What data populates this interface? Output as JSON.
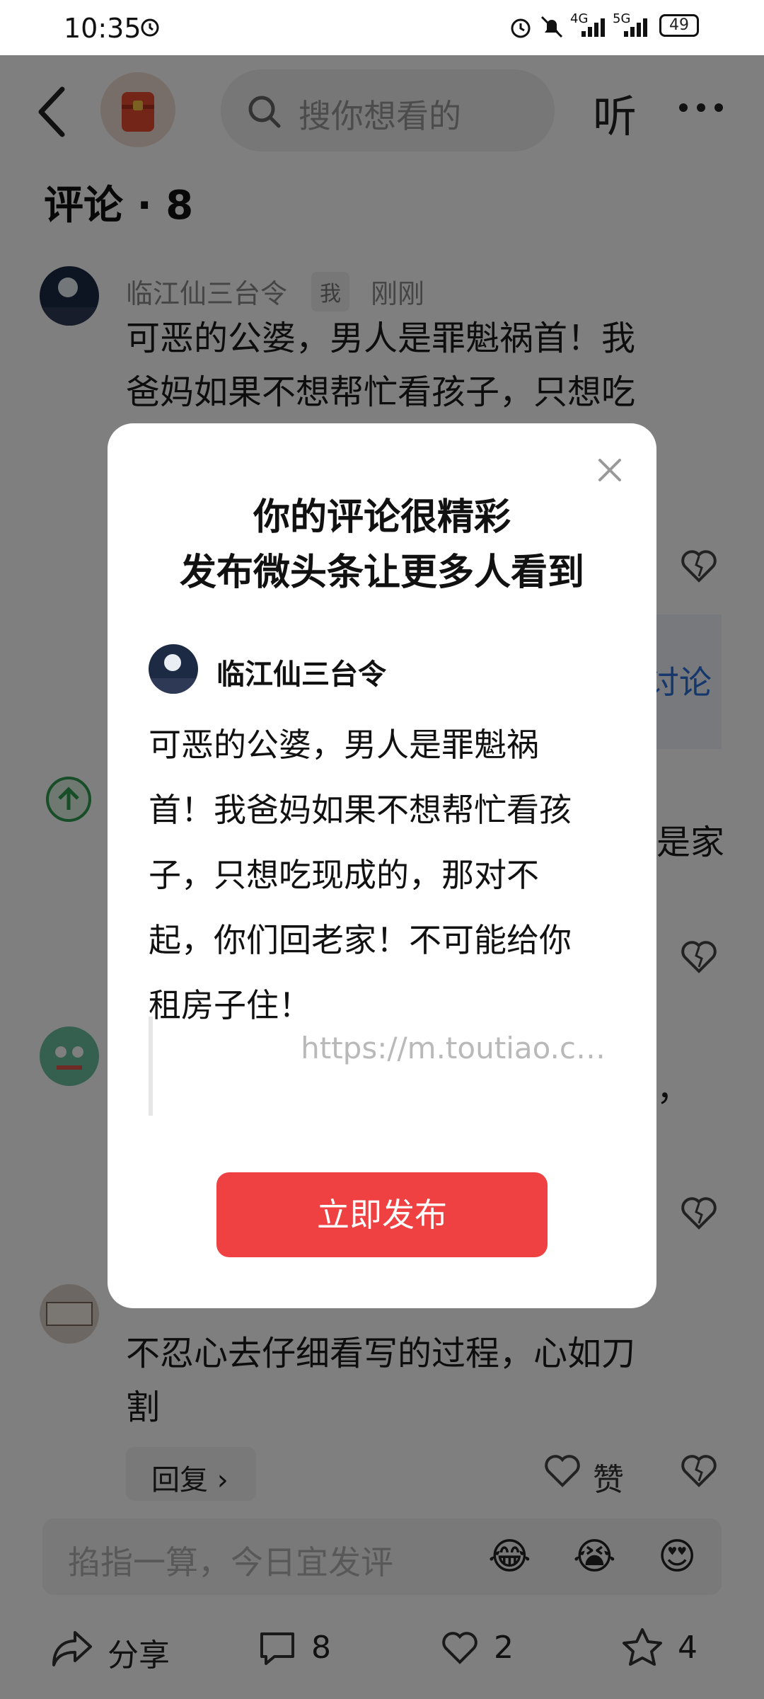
{
  "status_bar": {
    "time": "10:35",
    "network_1": "4G",
    "network_2": "5G",
    "battery": "49"
  },
  "header": {
    "search_placeholder": "搜你想看的",
    "listen_label": "听"
  },
  "comments": {
    "title": "评论 · 8",
    "first": {
      "user": "临江仙三台令",
      "me_tag": "我",
      "time": "刚刚",
      "line1": "可恶的公婆，男人是罪魁祸首！我",
      "line2": "爸妈如果不想帮忙看孩子，只想吃"
    },
    "partial_right_1": "讨论",
    "partial_right_2": "是家",
    "partial_right_3": "，",
    "last_text_line1": "不忍心去仔细看写的过程，心如刀",
    "last_text_line2": "割",
    "reply_label": "回复 ›",
    "like_label": "赞"
  },
  "input_bar": {
    "placeholder": "掐指一算，今日宜发评"
  },
  "bottom": {
    "share_label": "分享",
    "comments_count": "8",
    "likes_count": "2",
    "favorites_count": "4"
  },
  "modal": {
    "title_line1": "你的评论很精彩",
    "title_line2": "发布微头条让更多人看到",
    "username": "临江仙三台令",
    "body_lines": [
      "可恶的公婆，男人是罪魁祸",
      "首！我爸妈如果不想帮忙看孩",
      "子，只想吃现成的，那对不",
      "起，你们回老家！不可能给你",
      "租房子住！"
    ],
    "link": "https://m.toutiao.c…",
    "publish_label": "立即发布"
  },
  "colors": {
    "accent": "#f04142",
    "link_blue": "#2a6fd6"
  }
}
